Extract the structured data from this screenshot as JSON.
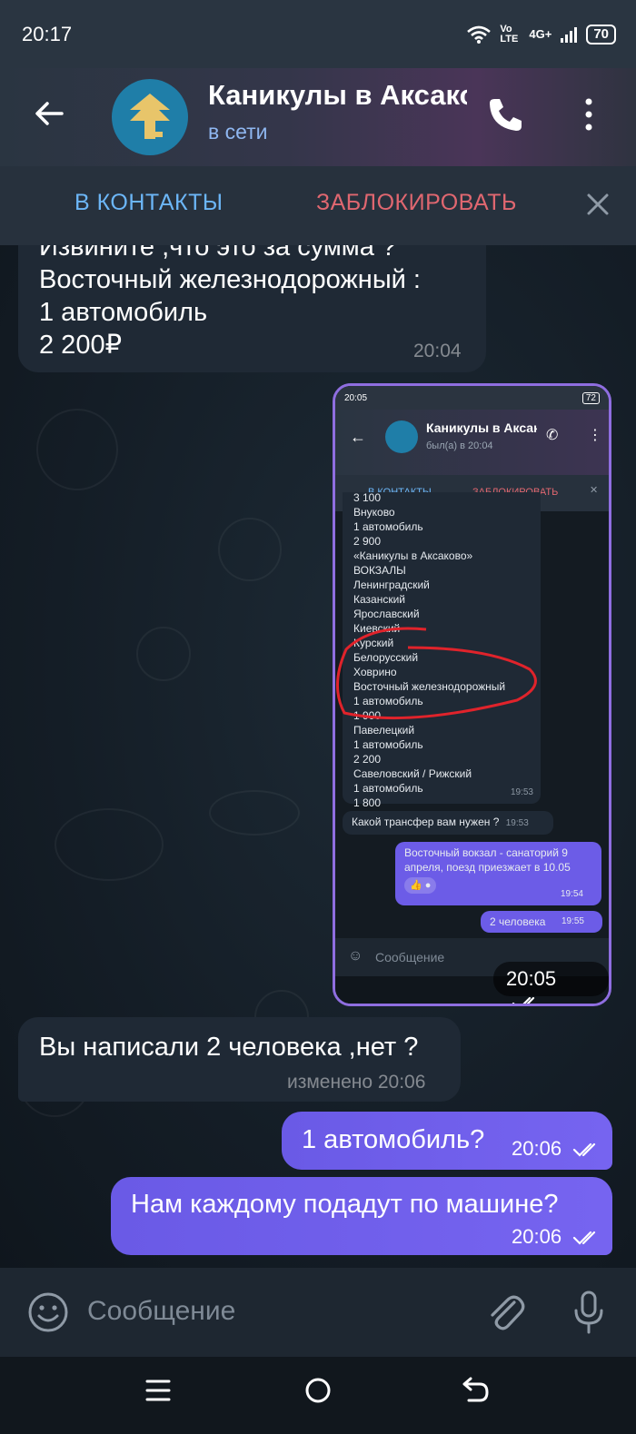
{
  "status_bar": {
    "time": "20:17",
    "network_volte": "Vo LTE",
    "network_4g": "4G+",
    "battery": "70"
  },
  "header": {
    "title": "Каникулы в Аксаково",
    "status": "в сети"
  },
  "action_bar": {
    "add_contact": "В КОНТАКТЫ",
    "block": "ЗАБЛОКИРОВАТЬ"
  },
  "messages": [
    {
      "direction": "incoming",
      "lines": [
        "Извините ,что это за сумма ?",
        "Восточный железнодорожный :",
        "1 автомобиль",
        "2 200₽"
      ],
      "time": "20:04"
    },
    {
      "direction": "outgoing",
      "type": "screenshot",
      "time": "20:05"
    },
    {
      "direction": "incoming",
      "lines": [
        "Вы написали 2 человека ,нет ?"
      ],
      "time": "изменено 20:06"
    },
    {
      "direction": "outgoing",
      "lines": [
        "1 автомобиль?"
      ],
      "time": "20:06"
    },
    {
      "direction": "outgoing",
      "lines": [
        "Нам каждому подадут по машине?"
      ],
      "time": "20:06"
    }
  ],
  "embedded_screenshot": {
    "status_time": "20:05",
    "battery": "72",
    "title": "Каникулы в Аксаково",
    "status": "был(а) в 20:04",
    "add_contact": "В КОНТАКТЫ",
    "block": "ЗАБЛОКИРОВАТЬ",
    "list_lines": [
      "3 100",
      "Внуково",
      "1 автомобиль",
      "2 900",
      "«Каникулы в Аксаково»",
      "ВОКЗАЛЫ",
      "Ленинградский",
      "Казанский",
      "Ярославский",
      "Киевский",
      "Курский",
      "Белорусский",
      "Ховрино",
      "Восточный железнодорожный",
      "1 автомобиль",
      "1 900",
      "Павелецкий",
      "1 автомобиль",
      "2 200",
      "Савеловский / Рижский",
      "1 автомобиль",
      "1 800"
    ],
    "list_time": "19:53",
    "question": "Какой трансфер вам нужен ?",
    "question_time": "19:53",
    "reply1": "Восточный вокзал - санаторий 9 апреля, поезд приезжает в 10.05",
    "reply1_time": "19:54",
    "reply2": "2 человека",
    "reply2_time": "19:55",
    "input_placeholder": "Сообщение",
    "highlight_color": "#e0232b"
  },
  "input": {
    "placeholder": "Сообщение"
  },
  "colors": {
    "accent_outgoing": "#6c5ce7",
    "link_blue": "#6cb6f7",
    "danger_red": "#e06770",
    "status_online": "#8fb7f0"
  },
  "icons": [
    "back-arrow-icon",
    "phone-icon",
    "more-vert-icon",
    "close-icon",
    "emoji-icon",
    "paperclip-icon",
    "microphone-icon",
    "double-check-icon",
    "nav-menu-icon",
    "nav-home-icon",
    "nav-back-icon"
  ]
}
